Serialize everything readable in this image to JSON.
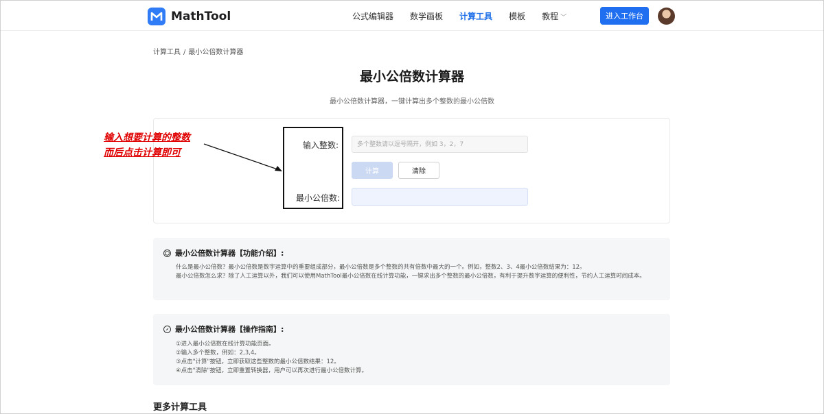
{
  "header": {
    "brand": "MathTool",
    "nav": [
      {
        "label": "公式编辑器"
      },
      {
        "label": "数学画板"
      },
      {
        "label": "计算工具",
        "active": true
      },
      {
        "label": "模板"
      },
      {
        "label": "教程",
        "has_dropdown": true
      }
    ],
    "cta_label": "进入工作台",
    "accent_color": "#1f6ff0"
  },
  "breadcrumb": {
    "root": "计算工具",
    "separator": "/",
    "current": "最小公倍数计算器"
  },
  "page": {
    "title": "最小公倍数计算器",
    "subtitle": "最小公倍数计算器，一键计算出多个整数的最小公倍数"
  },
  "calculator": {
    "input_label": "输入整数:",
    "input_placeholder": "多个整数请以逗号隔开，例如 3，2，7",
    "input_value": "",
    "calc_button": "计算",
    "clear_button": "清除",
    "result_label": "最小公倍数:",
    "result_value": ""
  },
  "annotation": {
    "line1": "输入想要计算的整数",
    "line2": "而后点击计算即可",
    "color": "#e00000"
  },
  "intro": {
    "title": "最小公倍数计算器【功能介绍】:",
    "lines": [
      "什么是最小公倍数？最小公倍数是数字运算中的重要组成部分，最小公倍数是多个整数的共有倍数中最大的一个。例如，整数2、3、4最小公倍数结果为：12。",
      "最小公倍数怎么求？除了人工运算以外，我们可以使用MathTool最小公倍数在线计算功能，一键求出多个整数的最小公倍数，有利于提升数字运算的便利性，节约人工运算时间成本。"
    ]
  },
  "guide": {
    "title": "最小公倍数计算器【操作指南】:",
    "steps": [
      "①进入最小公倍数在线计算功能页面。",
      "②输入多个整数，例如：2,3,4。",
      "③点击\"计算\"按钮，立即获取这些整数的最小公倍数结果：12。",
      "④点击\"清除\"按钮，立即重置转换器，用户可以再次进行最小公倍数计算。"
    ]
  },
  "more_tools_heading": "更多计算工具"
}
